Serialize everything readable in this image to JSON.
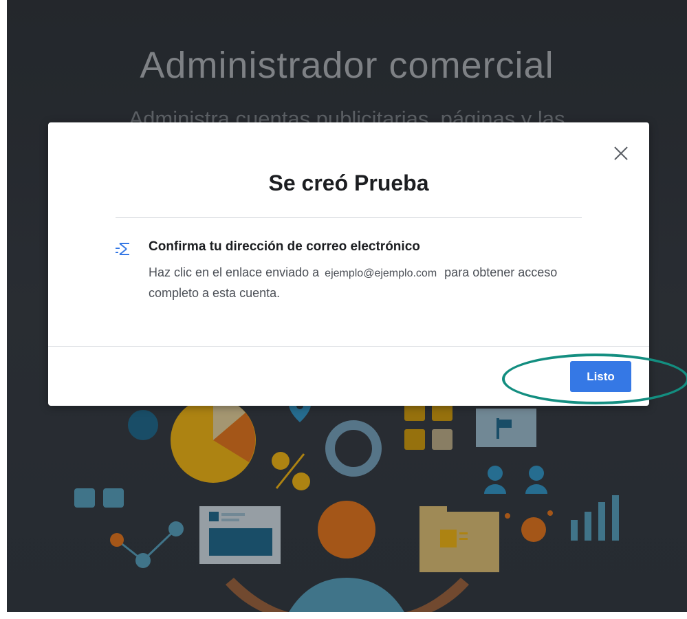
{
  "background": {
    "title": "Administrador comercial",
    "subtitle": "Administra cuentas publicitarias, páginas y las"
  },
  "modal": {
    "close_icon": "close-icon",
    "title": "Se creó Prueba",
    "notice": {
      "icon": "email-confirm-icon",
      "heading": "Confirma tu dirección de correo electrónico",
      "text_before": "Haz clic en el enlace enviado a",
      "email": "ejemplo@ejemplo.com",
      "text_after": "para obtener acceso completo a esta cuenta."
    },
    "done_label": "Listo"
  },
  "colors": {
    "primary_button": "#3578e5",
    "annotation_ring": "#138e80"
  }
}
